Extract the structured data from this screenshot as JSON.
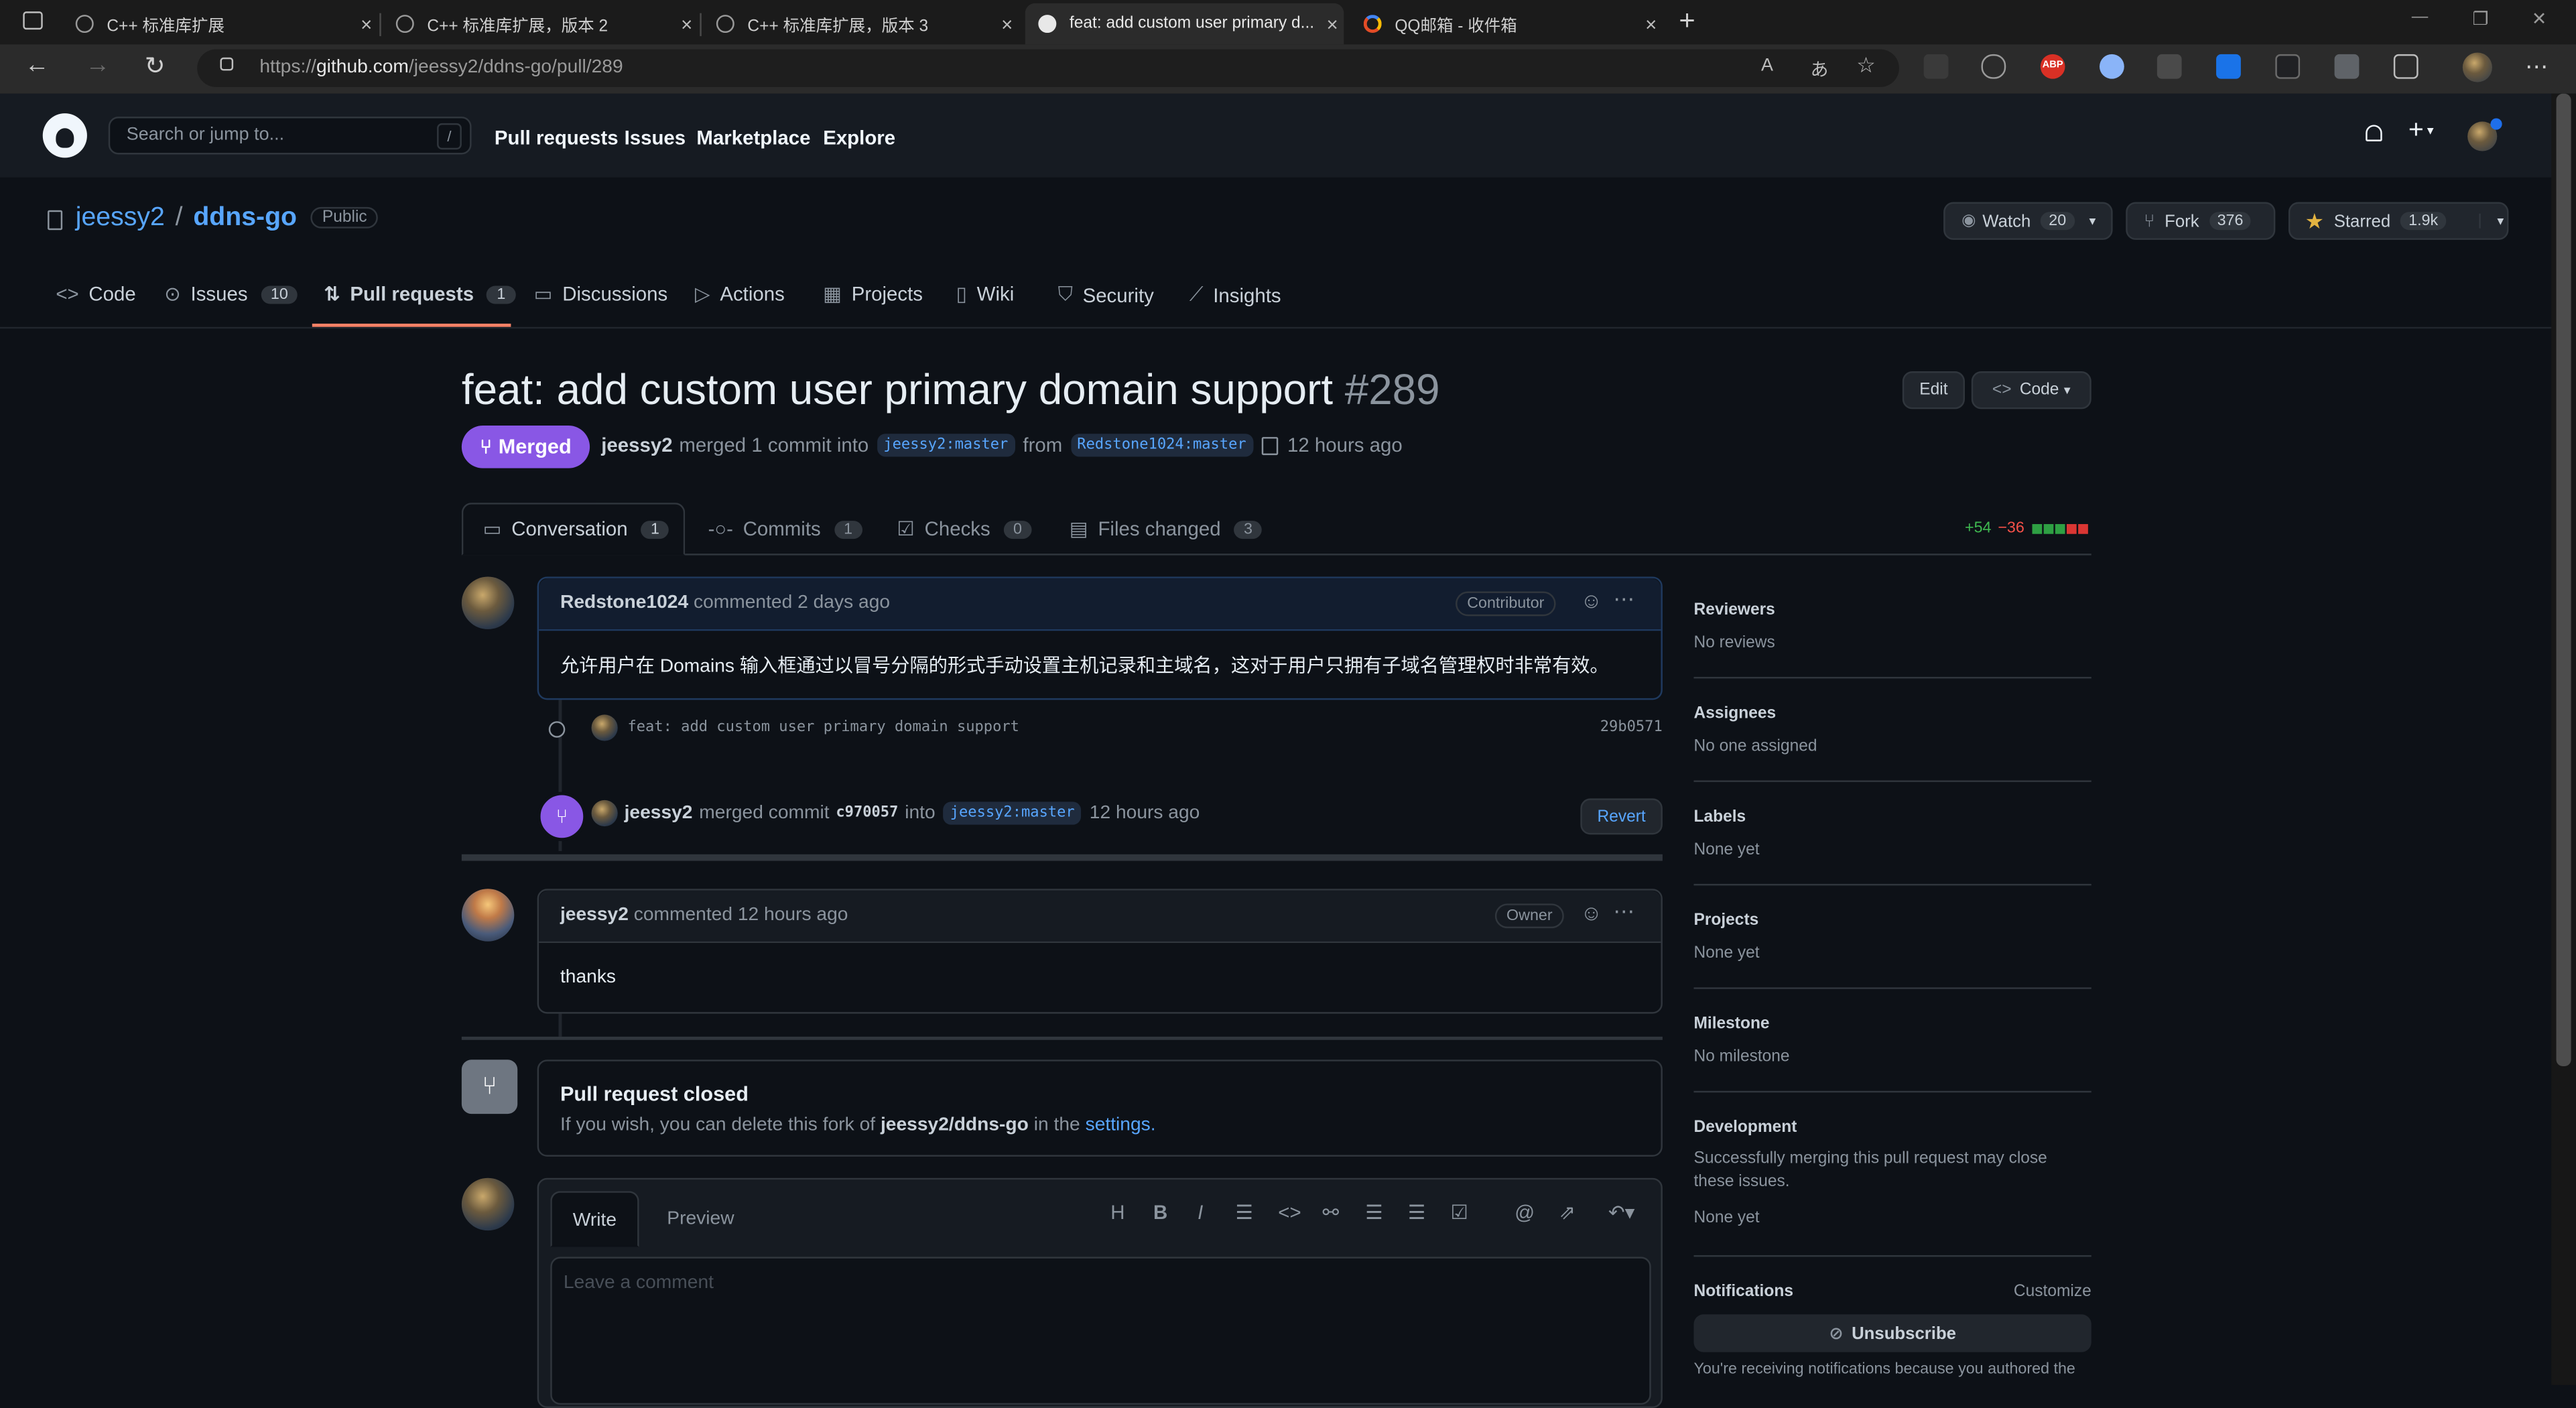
{
  "browser": {
    "tabs": [
      {
        "title": "C++ 标准库扩展",
        "close": "×"
      },
      {
        "title": "C++ 标准库扩展，版本 2",
        "close": "×"
      },
      {
        "title": "C++ 标准库扩展，版本 3",
        "close": "×"
      },
      {
        "title": "feat: add custom user primary d...",
        "close": "×"
      },
      {
        "title": "QQ邮箱 - 收件箱",
        "close": "×"
      }
    ],
    "new_tab": "+",
    "url_prefix": "https://",
    "url_host": "github.com",
    "url_path": "/jeessy2/ddns-go/pull/289",
    "window_controls": {
      "minimize": "—",
      "restore": "❐",
      "close": "✕"
    },
    "extension_labels": {
      "abp": "ABP"
    }
  },
  "gh_header": {
    "search_placeholder": "Search or jump to...",
    "search_key": "/",
    "links": [
      "Pull requests",
      "Issues",
      "Marketplace",
      "Explore"
    ],
    "new_icon": "+"
  },
  "repo": {
    "owner": "jeessy2",
    "sep": "/",
    "name": "ddns-go",
    "visibility": "Public",
    "watch_label": "Watch",
    "watch_count": "20",
    "fork_label": "Fork",
    "fork_count": "376",
    "star_label": "Starred",
    "star_count": "1.9k",
    "nav": [
      {
        "label": "Code",
        "icon": "code-icon"
      },
      {
        "label": "Issues",
        "count": "10",
        "icon": "issue-icon"
      },
      {
        "label": "Pull requests",
        "count": "1",
        "icon": "pr-icon"
      },
      {
        "label": "Discussions",
        "icon": "discussion-icon"
      },
      {
        "label": "Actions",
        "icon": "play-icon"
      },
      {
        "label": "Projects",
        "icon": "table-icon"
      },
      {
        "label": "Wiki",
        "icon": "book-icon"
      },
      {
        "label": "Security",
        "icon": "shield-icon"
      },
      {
        "label": "Insights",
        "icon": "graph-icon"
      }
    ]
  },
  "pr": {
    "title": "feat: add custom user primary domain support",
    "number": "#289",
    "state": "Merged",
    "meta": {
      "author": "jeessy2",
      "action": "merged 1 commit into",
      "base": "jeessy2:master",
      "from": "from",
      "head": "Redstone1024:master",
      "time": "12 hours ago"
    },
    "edit_label": "Edit",
    "code_label": "Code",
    "tabs": [
      {
        "label": "Conversation",
        "count": "1"
      },
      {
        "label": "Commits",
        "count": "1"
      },
      {
        "label": "Checks",
        "count": "0"
      },
      {
        "label": "Files changed",
        "count": "3"
      }
    ],
    "additions": "+54",
    "deletions": "−36",
    "diff_blocks": [
      "#2ea043",
      "#2ea043",
      "#2ea043",
      "#da3633",
      "#da3633"
    ]
  },
  "timeline": {
    "comment1": {
      "author": "Redstone1024",
      "when": "commented 2 days ago",
      "role": "Contributor",
      "body": "允许用户在 Domains 输入框通过以冒号分隔的形式手动设置主机记录和主域名，这对于用户只拥有子域名管理权时非常有效。"
    },
    "commit": {
      "message": "feat: add custom user primary domain support",
      "sha": "29b0571"
    },
    "merge": {
      "author": "jeessy2",
      "action": "merged commit",
      "sha": "c970057",
      "into": "into",
      "branch": "jeessy2:master",
      "time": "12 hours ago",
      "revert": "Revert"
    },
    "comment2": {
      "author": "jeessy2",
      "when": "commented 12 hours ago",
      "role": "Owner",
      "body": "thanks"
    },
    "closed": {
      "title": "Pull request closed",
      "text_before": "If you wish, you can delete this fork of",
      "repo": "jeessy2/ddns-go",
      "text_mid": "in the",
      "link": "settings."
    },
    "form": {
      "write": "Write",
      "preview": "Preview",
      "placeholder": "Leave a comment",
      "heading_icon": "H",
      "bold_icon": "B",
      "italic_icon": "I"
    }
  },
  "sidebar": {
    "sections": [
      {
        "title": "Reviewers",
        "value": "No reviews"
      },
      {
        "title": "Assignees",
        "value": "No one assigned"
      },
      {
        "title": "Labels",
        "value": "None yet"
      },
      {
        "title": "Projects",
        "value": "None yet"
      },
      {
        "title": "Milestone",
        "value": "No milestone"
      }
    ],
    "development": {
      "title": "Development",
      "text": "Successfully merging this pull request may close these issues.",
      "value": "None yet"
    },
    "notifications": {
      "title": "Notifications",
      "customize": "Customize",
      "unsubscribe": "Unsubscribe",
      "note": "You're receiving notifications because you authored the"
    }
  }
}
